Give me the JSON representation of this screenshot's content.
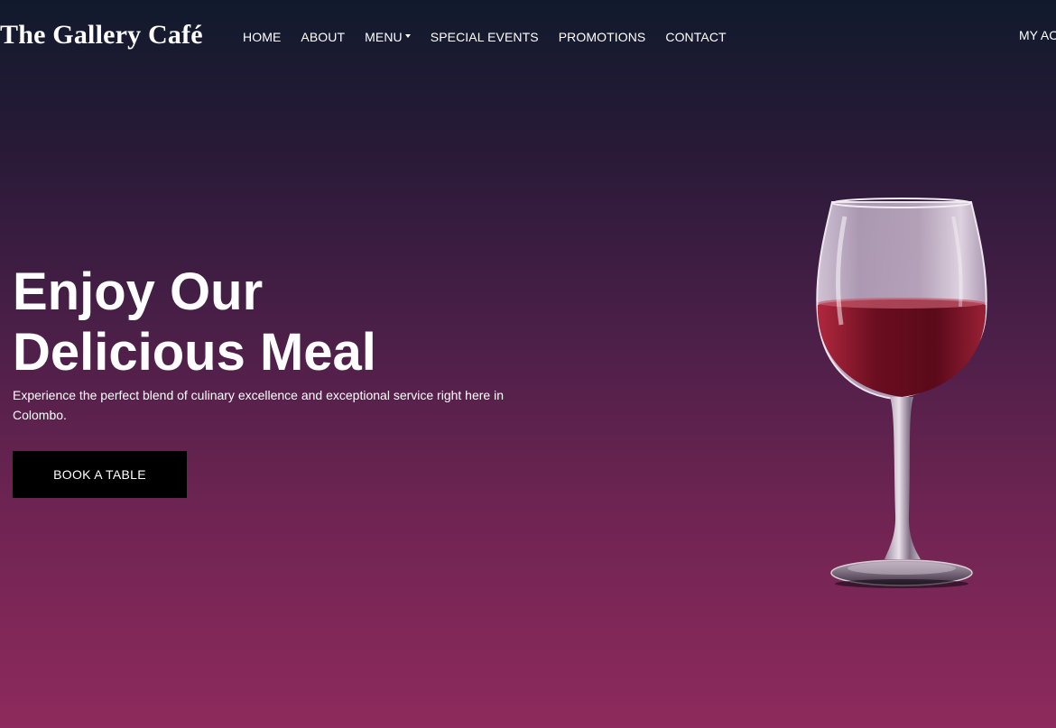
{
  "brand": "The Gallery Café",
  "nav": {
    "items": [
      {
        "label": "HOME"
      },
      {
        "label": "ABOUT"
      },
      {
        "label": "MENU"
      },
      {
        "label": "SPECIAL EVENTS"
      },
      {
        "label": "PROMOTIONS"
      },
      {
        "label": "CONTACT"
      }
    ],
    "account_label": "MY AC"
  },
  "hero": {
    "title_line1": "Enjoy Our",
    "title_line2": "Delicious Meal",
    "subtitle": "Experience the perfect blend of culinary excellence and exceptional service right here in Colombo.",
    "cta_label": "BOOK A TABLE",
    "image_icon": "wine-glass-icon"
  },
  "colors": {
    "gradient_top": "#111a2d",
    "gradient_bottom": "#8e2a5d",
    "button_bg": "#000000",
    "text": "#ffffff",
    "wine": "#7a1022"
  }
}
